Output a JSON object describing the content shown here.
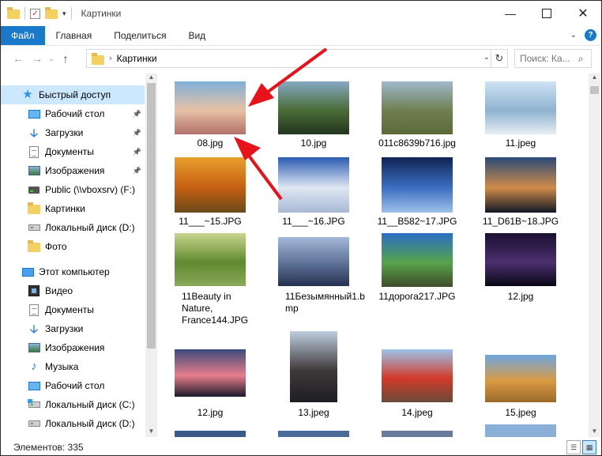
{
  "window": {
    "title": "Картинки"
  },
  "titlebar": {
    "minimize_icon": "minimize-icon",
    "maximize_icon": "maximize-icon",
    "close_icon": "close-icon"
  },
  "ribbon": {
    "tabs": [
      "Файл",
      "Главная",
      "Поделиться",
      "Вид"
    ]
  },
  "address": {
    "crumb": "Картинки"
  },
  "search": {
    "placeholder": "Поиск: Ка..."
  },
  "nav": {
    "quick_access": "Быстрый доступ",
    "items": [
      {
        "label": "Рабочий стол",
        "icon": "desktop-icon",
        "pinned": true
      },
      {
        "label": "Загрузки",
        "icon": "downloads-icon",
        "pinned": true
      },
      {
        "label": "Документы",
        "icon": "documents-icon",
        "pinned": true
      },
      {
        "label": "Изображения",
        "icon": "pictures-icon",
        "pinned": true
      },
      {
        "label": "Public (\\\\vboxsrv) (F:)",
        "icon": "network-drive-icon",
        "pinned": false
      },
      {
        "label": "Картинки",
        "icon": "folder-icon",
        "pinned": false
      },
      {
        "label": "Локальный диск (D:)",
        "icon": "disk-icon",
        "pinned": false
      },
      {
        "label": "Фото",
        "icon": "folder-icon",
        "pinned": false
      }
    ],
    "this_pc": "Этот компьютер",
    "pc_items": [
      {
        "label": "Видео",
        "icon": "video-icon"
      },
      {
        "label": "Документы",
        "icon": "documents-icon"
      },
      {
        "label": "Загрузки",
        "icon": "downloads-icon"
      },
      {
        "label": "Изображения",
        "icon": "pictures-icon"
      },
      {
        "label": "Музыка",
        "icon": "music-icon"
      },
      {
        "label": "Рабочий стол",
        "icon": "desktop-icon"
      },
      {
        "label": "Локальный диск (C:)",
        "icon": "system-disk-icon"
      },
      {
        "label": "Локальный диск (D:)",
        "icon": "disk-icon"
      }
    ]
  },
  "files": [
    {
      "name": "08.jpg",
      "colors": [
        "#7fb0d8",
        "#e8c1a5",
        "#b0706a"
      ]
    },
    {
      "name": "10.jpg",
      "colors": [
        "#86a9c4",
        "#4a6b36",
        "#23351f"
      ]
    },
    {
      "name": "011c8639b716.jpg",
      "colors": [
        "#9fb8cc",
        "#6f7f50",
        "#5c6a3a"
      ]
    },
    {
      "name": "11.jpeg",
      "colors": [
        "#cfe3f3",
        "#8fb2cf",
        "#e6eef4"
      ]
    },
    {
      "name": "11___~15.JPG",
      "colors": [
        "#e9a02c",
        "#c55f12",
        "#6a4a1a"
      ]
    },
    {
      "name": "11___~16.JPG",
      "colors": [
        "#2b5bb3",
        "#dfe7f2",
        "#a8b8d4"
      ]
    },
    {
      "name": "11__B582~17.JPG",
      "colors": [
        "#0f2453",
        "#3c6ec2",
        "#9ec1ea"
      ]
    },
    {
      "name": "11_D61B~18.JPG",
      "colors": [
        "#294a78",
        "#d08b4a",
        "#111827"
      ]
    },
    {
      "name": "11Beauty in Nature, France144.JPG",
      "colors": [
        "#c9d58e",
        "#5f8a2e",
        "#8aa95a"
      ]
    },
    {
      "name": "11Безымянный1.bmp",
      "colors": [
        "#a3b7d8",
        "#5c7096",
        "#253050"
      ]
    },
    {
      "name": "11дорога217.JPG",
      "colors": [
        "#2a6ec4",
        "#58a34a",
        "#3f4b2a"
      ]
    },
    {
      "name": "12.jpg",
      "colors": [
        "#1b1030",
        "#4b2f6e",
        "#0b0818"
      ]
    },
    {
      "name": "12.jpg",
      "colors": [
        "#3a4a7c",
        "#e87e8c",
        "#1b1a2b"
      ]
    },
    {
      "name": "13.jpeg",
      "colors": [
        "#bfcde0",
        "#3f3a3a",
        "#1e1d24"
      ]
    },
    {
      "name": "14.jpeg",
      "colors": [
        "#9cc3ea",
        "#d23a2a",
        "#6a4a3a"
      ]
    },
    {
      "name": "15.jpeg",
      "colors": [
        "#6ea6e0",
        "#d99a43",
        "#9a6a2a"
      ]
    }
  ],
  "status": {
    "count": "Элементов: 335"
  },
  "annotation": {
    "arrow_color": "#e8121b"
  }
}
